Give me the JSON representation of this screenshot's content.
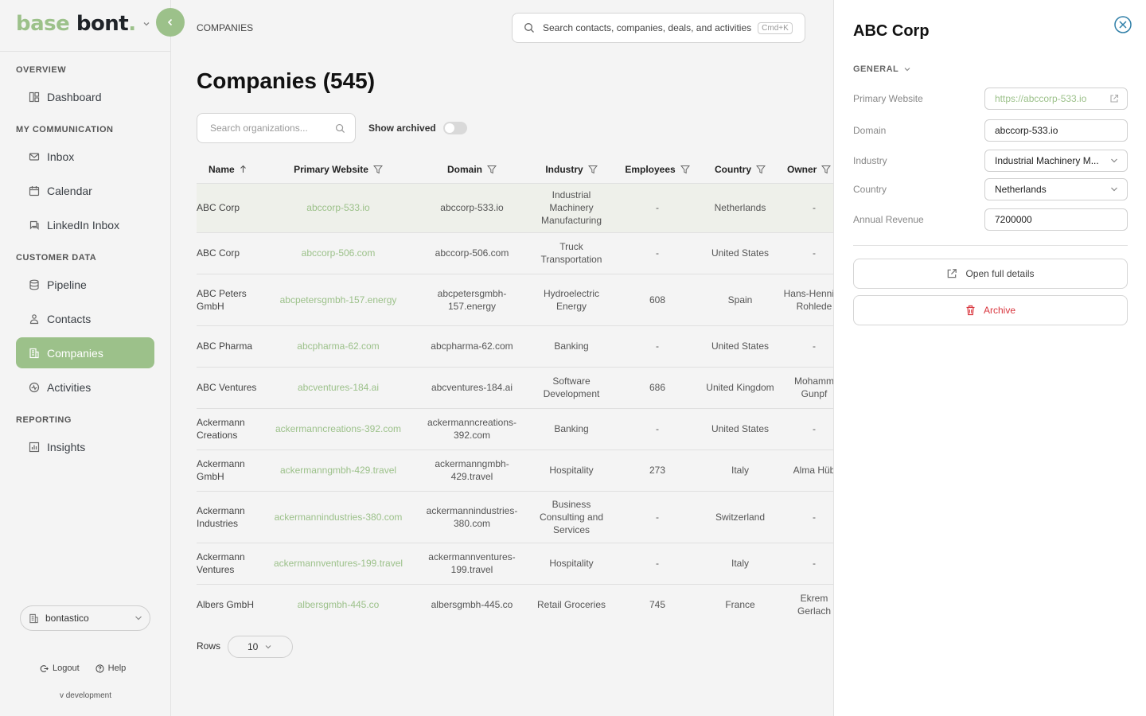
{
  "brand": {
    "part1": "base",
    "part2": "bont",
    "dot": "."
  },
  "sidebar": {
    "sections": [
      {
        "label": "OVERVIEW",
        "items": [
          {
            "label": "Dashboard",
            "icon": "dashboard-icon"
          }
        ]
      },
      {
        "label": "MY COMMUNICATION",
        "items": [
          {
            "label": "Inbox",
            "icon": "mail-icon"
          },
          {
            "label": "Calendar",
            "icon": "calendar-icon"
          },
          {
            "label": "LinkedIn Inbox",
            "icon": "chat-icon"
          }
        ]
      },
      {
        "label": "CUSTOMER DATA",
        "items": [
          {
            "label": "Pipeline",
            "icon": "database-icon"
          },
          {
            "label": "Contacts",
            "icon": "contacts-icon"
          },
          {
            "label": "Companies",
            "icon": "building-icon"
          },
          {
            "label": "Activities",
            "icon": "activity-icon"
          }
        ]
      },
      {
        "label": "REPORTING",
        "items": [
          {
            "label": "Insights",
            "icon": "chart-icon"
          }
        ]
      }
    ],
    "workspace": "bontastico",
    "logout": "Logout",
    "help": "Help",
    "version": "v development"
  },
  "header": {
    "breadcrumb": "COMPANIES",
    "search_placeholder": "Search contacts, companies, deals, and activities",
    "search_shortcut": "Cmd+K"
  },
  "main": {
    "title": "Companies (545)",
    "org_search_placeholder": "Search organizations...",
    "show_archived": "Show archived",
    "rows_label": "Rows",
    "rows_value": "10"
  },
  "table": {
    "columns": [
      "Name",
      "Primary Website",
      "Domain",
      "Industry",
      "Employees",
      "Country",
      "Owner"
    ],
    "rows": [
      {
        "name": "ABC Corp",
        "website": "abccorp-533.io",
        "domain": "abccorp-533.io",
        "industry": "Industrial Machinery Manufacturing",
        "employees": "-",
        "country": "Netherlands",
        "owner": "-"
      },
      {
        "name": "ABC Corp",
        "website": "abccorp-506.com",
        "domain": "abccorp-506.com",
        "industry": "Truck Transportation",
        "employees": "-",
        "country": "United States",
        "owner": "-"
      },
      {
        "name": "ABC Peters GmbH",
        "website": "abcpetersgmbh-157.energy",
        "domain": "abcpetersgmbh-157.energy",
        "industry": "Hydroelectric Energy",
        "employees": "608",
        "country": "Spain",
        "owner": "Hans-Henning Rohlede"
      },
      {
        "name": "ABC Pharma",
        "website": "abcpharma-62.com",
        "domain": "abcpharma-62.com",
        "industry": "Banking",
        "employees": "-",
        "country": "United States",
        "owner": "-"
      },
      {
        "name": "ABC Ventures",
        "website": "abcventures-184.ai",
        "domain": "abcventures-184.ai",
        "industry": "Software Development",
        "employees": "686",
        "country": "United Kingdom",
        "owner": "Mohamm Gunpf"
      },
      {
        "name": "Ackermann Creations",
        "website": "ackermanncreations-392.com",
        "domain": "ackermanncreations-392.com",
        "industry": "Banking",
        "employees": "-",
        "country": "United States",
        "owner": "-"
      },
      {
        "name": "Ackermann GmbH",
        "website": "ackermanngmbh-429.travel",
        "domain": "ackermanngmbh-429.travel",
        "industry": "Hospitality",
        "employees": "273",
        "country": "Italy",
        "owner": "Alma Hüb"
      },
      {
        "name": "Ackermann Industries",
        "website": "ackermannindustries-380.com",
        "domain": "ackermannindustries-380.com",
        "industry": "Business Consulting and Services",
        "employees": "-",
        "country": "Switzerland",
        "owner": "-"
      },
      {
        "name": "Ackermann Ventures",
        "website": "ackermannventures-199.travel",
        "domain": "ackermannventures-199.travel",
        "industry": "Hospitality",
        "employees": "-",
        "country": "Italy",
        "owner": "-"
      },
      {
        "name": "Albers GmbH",
        "website": "albersgmbh-445.co",
        "domain": "albersgmbh-445.co",
        "industry": "Retail Groceries",
        "employees": "745",
        "country": "France",
        "owner": "Ekrem Gerlach"
      }
    ]
  },
  "panel": {
    "title": "ABC Corp",
    "section": "GENERAL",
    "fields": {
      "primary_website": {
        "label": "Primary Website",
        "value": "https://abccorp-533.io"
      },
      "domain": {
        "label": "Domain",
        "value": "abccorp-533.io"
      },
      "industry": {
        "label": "Industry",
        "value": "Industrial Machinery M..."
      },
      "country": {
        "label": "Country",
        "value": "Netherlands"
      },
      "annual_revenue": {
        "label": "Annual Revenue",
        "value": "7200000"
      }
    },
    "open_details": "Open full details",
    "archive": "Archive"
  },
  "colors": {
    "accent": "#9cc18a",
    "danger": "#d9363e",
    "close": "#2f7fa8"
  }
}
